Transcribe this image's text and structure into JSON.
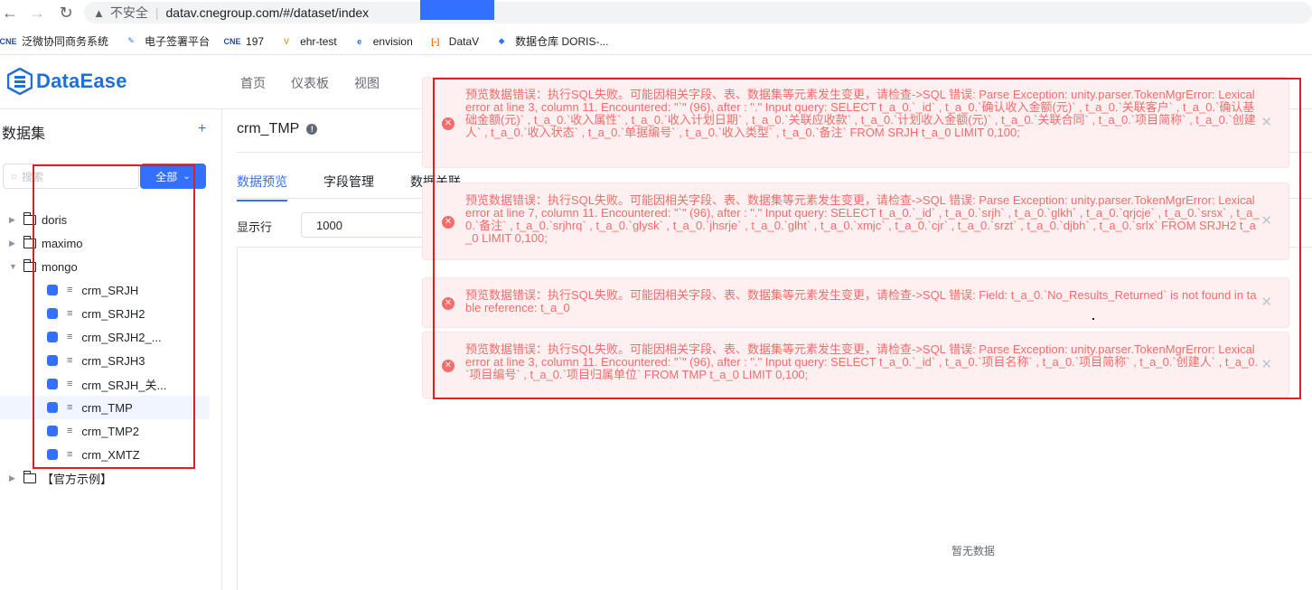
{
  "browser": {
    "insecure_label": "不安全",
    "url": "datav.cnegroup.com/#/dataset/index",
    "bookmarks": [
      {
        "icon": "CNE",
        "label": "泛微协同商务系统",
        "color": "#1e4fa3"
      },
      {
        "icon": "✎",
        "label": "电子签署平台",
        "color": "#3370ff"
      },
      {
        "icon": "CNE",
        "label": "197",
        "color": "#1e4fa3"
      },
      {
        "icon": "V",
        "label": "ehr-test",
        "color": "#e6a23c"
      },
      {
        "icon": "e",
        "label": "envision",
        "color": "#1e6fd9"
      },
      {
        "icon": "[-]",
        "label": "DataV",
        "color": "#ff6a00"
      },
      {
        "icon": "◆",
        "label": "数据仓库 DORIS-...",
        "color": "#3370ff"
      }
    ]
  },
  "header": {
    "logo_text": "DataEase",
    "nav": [
      "首页",
      "仪表板",
      "视图"
    ]
  },
  "sidebar": {
    "title": "数据集",
    "add": "+",
    "search_placeholder": "搜索",
    "filter_label": "全部",
    "folders": [
      {
        "label": "doris",
        "expanded": false
      },
      {
        "label": "maximo",
        "expanded": false
      },
      {
        "label": "mongo",
        "expanded": true
      }
    ],
    "children": [
      "crm_SRJH",
      "crm_SRJH2",
      "crm_SRJH2_...",
      "crm_SRJH3",
      "crm_SRJH_关...",
      "crm_TMP",
      "crm_TMP2",
      "crm_XMTZ"
    ],
    "last_folder": "【官方示例】"
  },
  "main": {
    "title": "crm_TMP",
    "tabs": [
      "数据预览",
      "字段管理",
      "数据关联"
    ],
    "rows_label": "显示行",
    "rows_value": "1000",
    "no_data": "暂无数据"
  },
  "errors": [
    "预览数据错误：执行SQL失败。可能因相关字段、表、数据集等元素发生变更，请检查->SQL 错误: Parse Exception: unity.parser.TokenMgrError: Lexical error at line 3, column 11. Encountered: \"`\" (96), after : \".\" Input query: SELECT t_a_0.`_id` , t_a_0.`确认收入金额(元)` , t_a_0.`关联客户` , t_a_0.`确认基础金额(元)` , t_a_0.`收入属性` , t_a_0.`收入计划日期` , t_a_0.`关联应收款` , t_a_0.`计划收入金额(元)` , t_a_0.`关联合同` , t_a_0.`项目简称` , t_a_0.`创建人` , t_a_0.`收入状态` , t_a_0.`单据编号` , t_a_0.`收入类型` , t_a_0.`备注` FROM SRJH t_a_0 LIMIT 0,100;",
    "预览数据错误：执行SQL失败。可能因相关字段、表、数据集等元素发生变更，请检查->SQL 错误: Parse Exception: unity.parser.TokenMgrError: Lexical error at line 7, column 11. Encountered: \"`\" (96), after : \".\" Input query: SELECT t_a_0.`_id` , t_a_0.`srjh` , t_a_0.`glkh` , t_a_0.`qrjcje` , t_a_0.`srsx` , t_a_0.`备注` , t_a_0.`srjhrq` , t_a_0.`glysk` , t_a_0.`jhsrje` , t_a_0.`glht` , t_a_0.`xmjc` , t_a_0.`cjr` , t_a_0.`srzt` , t_a_0.`djbh` , t_a_0.`srlx` FROM SRJH2 t_a_0 LIMIT 0,100;",
    "预览数据错误：执行SQL失败。可能因相关字段、表、数据集等元素发生变更，请检查->SQL 错误: Field: t_a_0.`No_Results_Returned` is not found in table reference: t_a_0",
    "预览数据错误：执行SQL失败。可能因相关字段、表、数据集等元素发生变更，请检查->SQL 错误: Parse Exception: unity.parser.TokenMgrError: Lexical error at line 3, column 11. Encountered: \"`\" (96), after : \".\" Input query: SELECT t_a_0.`_id` , t_a_0.`项目名称` , t_a_0.`项目简称` , t_a_0.`创建人` , t_a_0.`项目编号` , t_a_0.`项目归属单位` FROM TMP t_a_0 LIMIT 0,100;"
  ],
  "colors": {
    "accent": "#3370ff",
    "error": "#f56c6c",
    "error_bg": "#fef0f0",
    "annotation": "#e02020"
  }
}
